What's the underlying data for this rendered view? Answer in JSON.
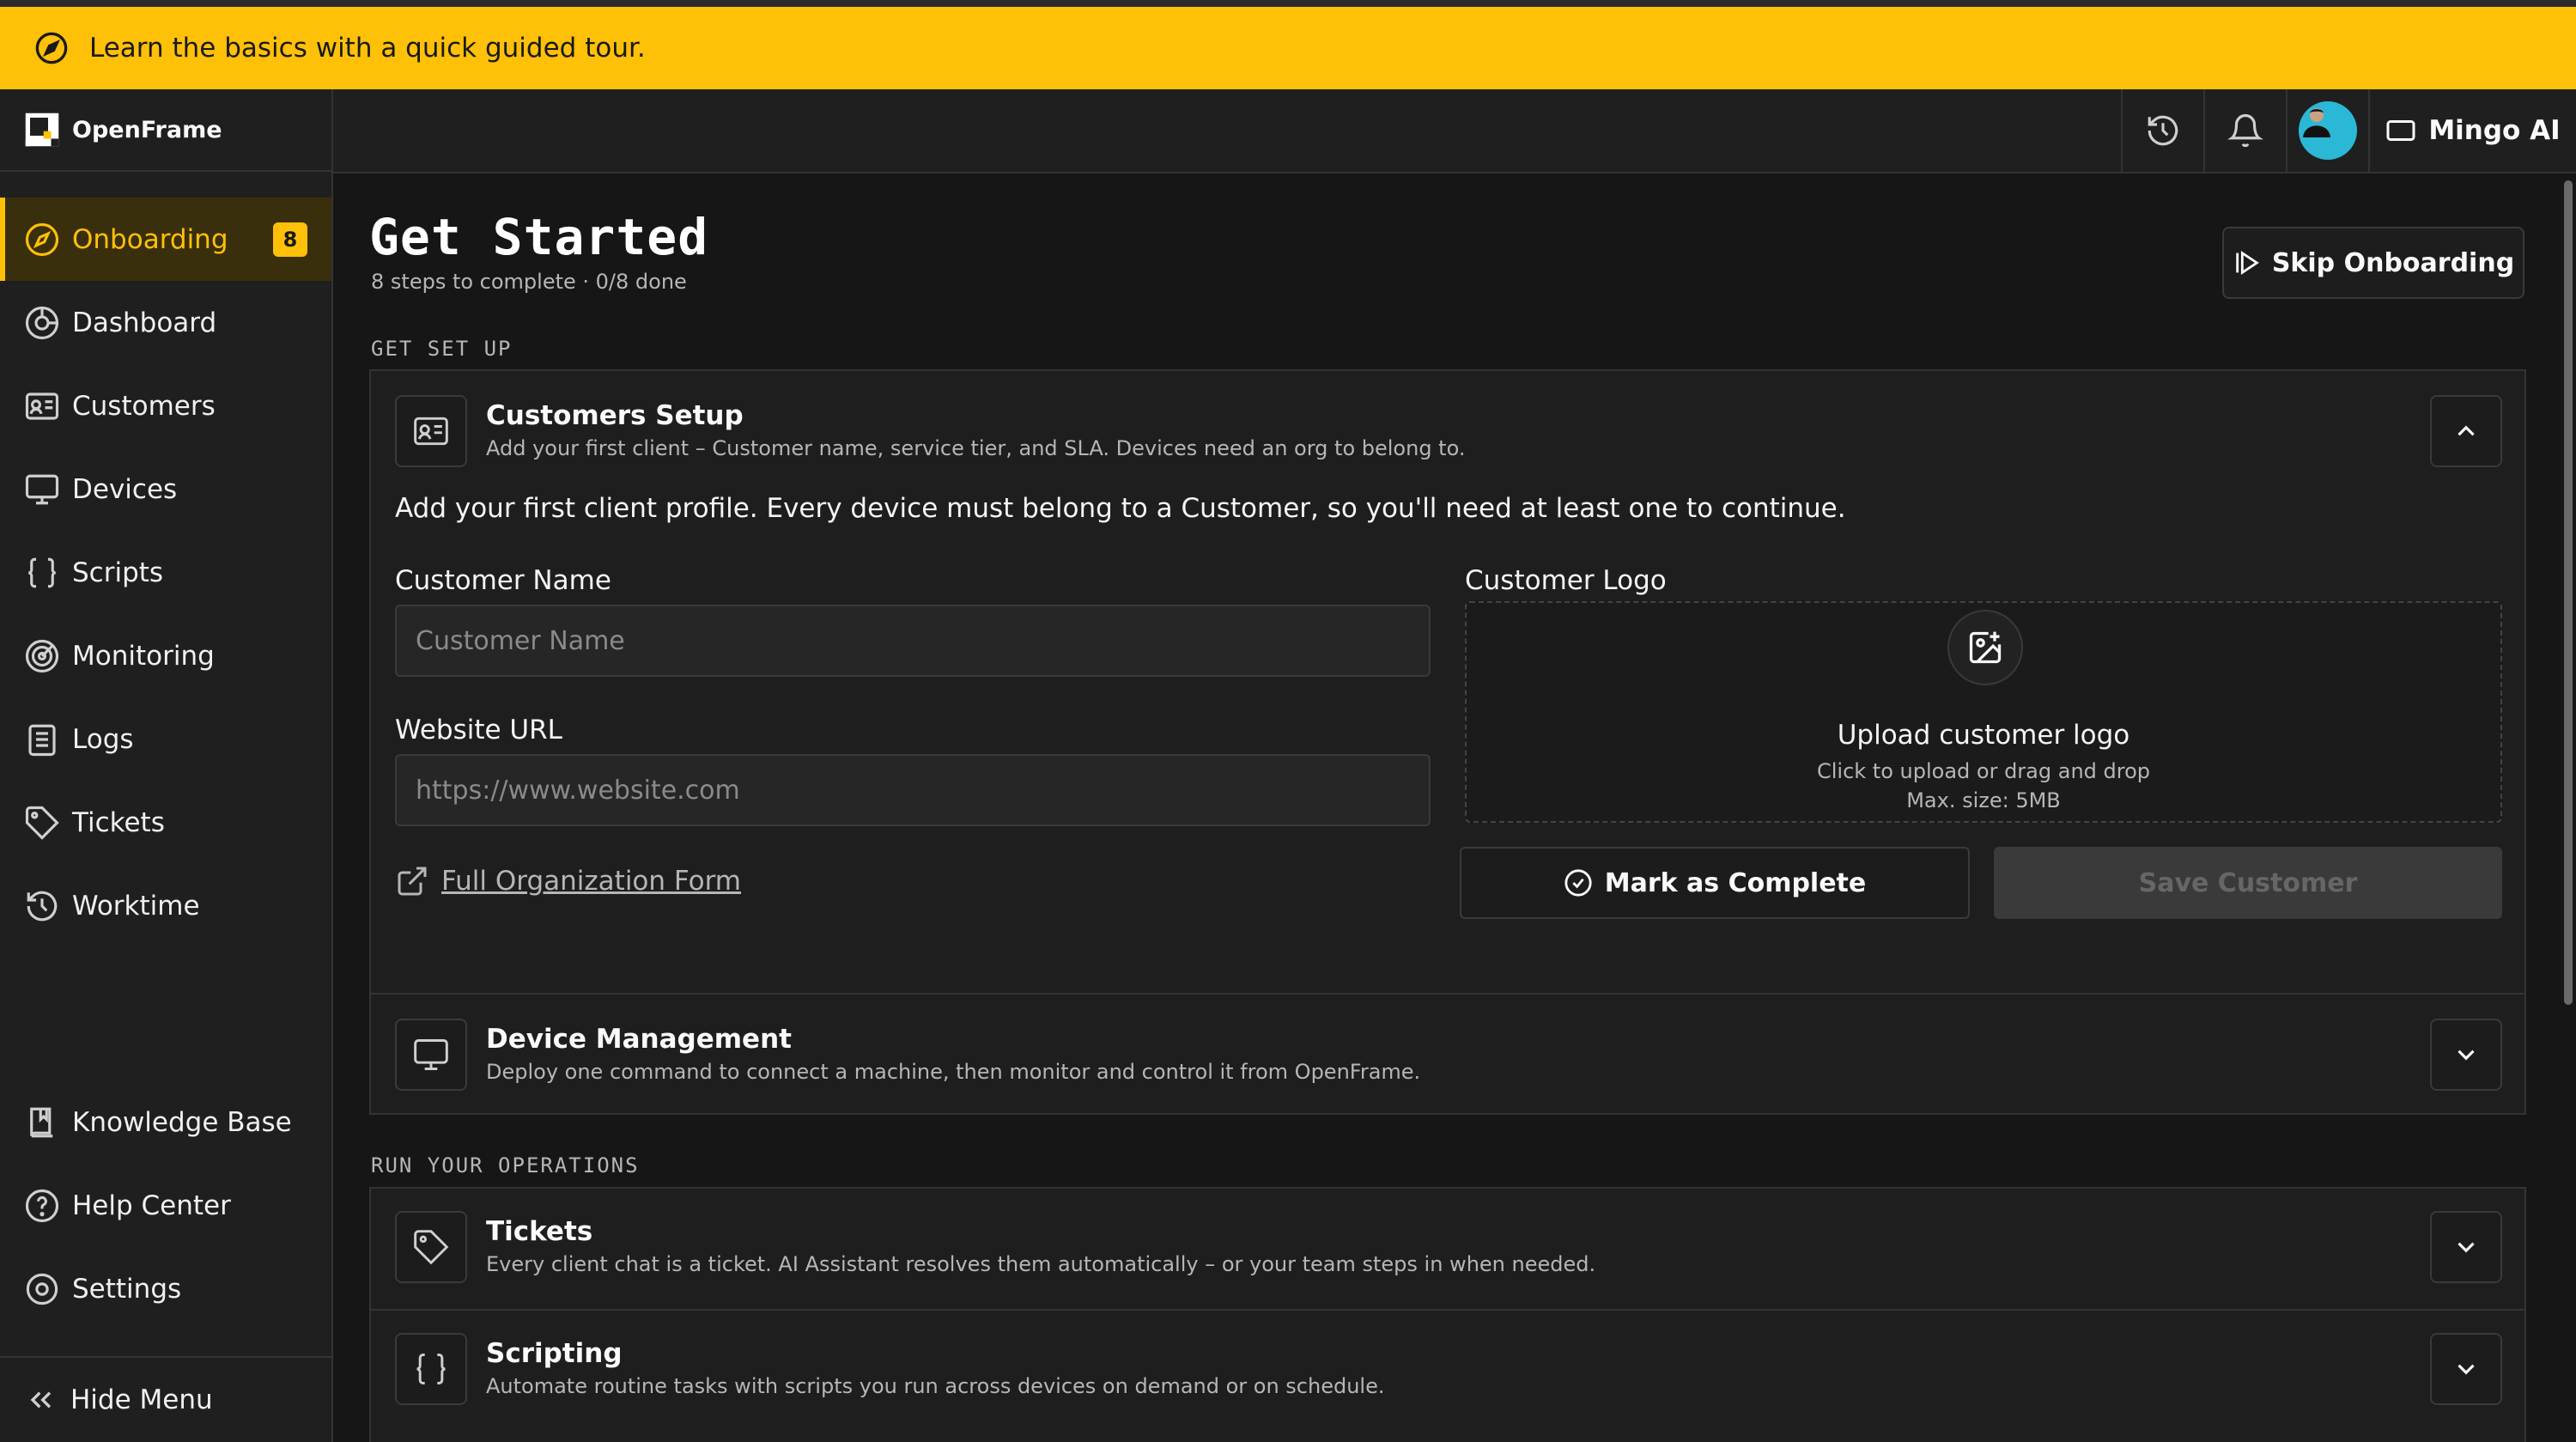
{
  "banner": {
    "text": "Learn the basics with a quick guided tour."
  },
  "brand": {
    "name": "OpenFrame"
  },
  "sidebar": {
    "items": [
      {
        "label": "Onboarding",
        "badge": "8",
        "active": true
      },
      {
        "label": "Dashboard"
      },
      {
        "label": "Customers"
      },
      {
        "label": "Devices"
      },
      {
        "label": "Scripts"
      },
      {
        "label": "Monitoring"
      },
      {
        "label": "Logs"
      },
      {
        "label": "Tickets"
      },
      {
        "label": "Worktime"
      }
    ],
    "bottom_items": [
      {
        "label": "Knowledge Base"
      },
      {
        "label": "Help Center"
      },
      {
        "label": "Settings"
      }
    ],
    "hide_menu": "Hide Menu"
  },
  "header": {
    "assistant_label": "Mingo AI"
  },
  "page": {
    "title": "Get Started",
    "subtitle": "8 steps to complete · 0/8 done",
    "skip_label": "Skip Onboarding"
  },
  "sections": {
    "setup_label": "GET SET UP",
    "ops_label": "RUN YOUR OPERATIONS"
  },
  "customers_setup": {
    "title": "Customers Setup",
    "description": "Add your first client – Customer name, service tier, and SLA. Devices need an org to belong to.",
    "intro": "Add your first client profile. Every device must belong to a Customer, so you'll need at least one to continue.",
    "name_label": "Customer Name",
    "name_placeholder": "Customer Name",
    "url_label": "Website URL",
    "url_placeholder": "https://www.website.com",
    "logo_label": "Customer Logo",
    "upload_title": "Upload customer logo",
    "upload_hint": "Click to upload or drag and drop",
    "upload_max": "Max. size: 5MB",
    "full_form_link": "Full Organization Form",
    "mark_complete": "Mark as Complete",
    "save": "Save Customer"
  },
  "device_management": {
    "title": "Device Management",
    "description": "Deploy one command to connect a machine, then monitor and control it from OpenFrame."
  },
  "tickets": {
    "title": "Tickets",
    "description": "Every client chat is a ticket. AI Assistant resolves them automatically – or your team steps in when needed."
  },
  "scripting": {
    "title": "Scripting",
    "description": "Automate routine tasks with scripts you run across devices on demand or on schedule."
  },
  "colors": {
    "accent": "#ffc008",
    "background": "#161616",
    "panel": "#1f1f1f"
  }
}
